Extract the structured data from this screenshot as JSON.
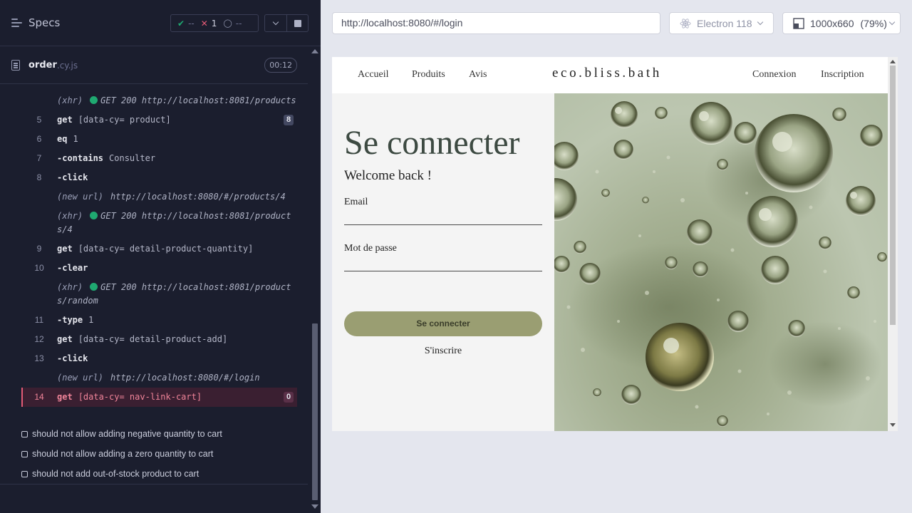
{
  "reporter": {
    "title": "Specs",
    "stats": {
      "passed": "--",
      "failed": "1",
      "pending": "--"
    },
    "spec": {
      "name": "order",
      "ext": ".cy.js",
      "duration": "00:12"
    },
    "commands": [
      {
        "num": "",
        "event": "(xhr)",
        "dot": true,
        "message": "GET 200 http://localhost:8081/products"
      },
      {
        "num": "5",
        "name": "get",
        "message": "[data-cy= product]",
        "badge": "8"
      },
      {
        "num": "6",
        "name": "eq",
        "message": "1"
      },
      {
        "num": "7",
        "name": "-contains",
        "message": "Consulter"
      },
      {
        "num": "8",
        "name": "-click",
        "message": ""
      },
      {
        "num": "",
        "event": "(new url)",
        "message": "http://localhost:8080/#/products/4"
      },
      {
        "num": "",
        "event": "(xhr)",
        "dot": true,
        "message": "GET 200 http://localhost:8081/products/4"
      },
      {
        "num": "9",
        "name": "get",
        "message": "[data-cy= detail-product-quantity]"
      },
      {
        "num": "10",
        "name": "-clear",
        "message": ""
      },
      {
        "num": "",
        "event": "(xhr)",
        "dot": true,
        "message": "GET 200 http://localhost:8081/products/random"
      },
      {
        "num": "11",
        "name": "-type",
        "message": "1"
      },
      {
        "num": "12",
        "name": "get",
        "message": "[data-cy= detail-product-add]"
      },
      {
        "num": "13",
        "name": "-click",
        "message": ""
      },
      {
        "num": "",
        "event": "(new url)",
        "message": "http://localhost:8080/#/login"
      },
      {
        "num": "14",
        "name": "get",
        "message": "[data-cy= nav-link-cart]",
        "badge": "0",
        "failed": true
      }
    ],
    "tests": [
      "should not allow adding negative quantity to cart",
      "should not allow adding a zero quantity to cart",
      "should not add out-of-stock product to cart"
    ]
  },
  "aut_header": {
    "url": "http://localhost:8080/#/login",
    "browser": "Electron 118",
    "viewport": "1000x660",
    "scale": "(79%)"
  },
  "site": {
    "nav": {
      "home": "Accueil",
      "products": "Produits",
      "reviews": "Avis",
      "login": "Connexion",
      "register": "Inscription"
    },
    "logo": "eco.bliss.bath",
    "login": {
      "title": "Se connecter",
      "welcome": "Welcome back !",
      "email_label": "Email",
      "password_label": "Mot de passe",
      "submit": "Se connecter",
      "register_link": "S'inscrire"
    }
  },
  "colors": {
    "pass": "#1fa971",
    "fail": "#e35a76",
    "button": "#9a9e72",
    "reporter_bg": "#1b1e2e"
  }
}
